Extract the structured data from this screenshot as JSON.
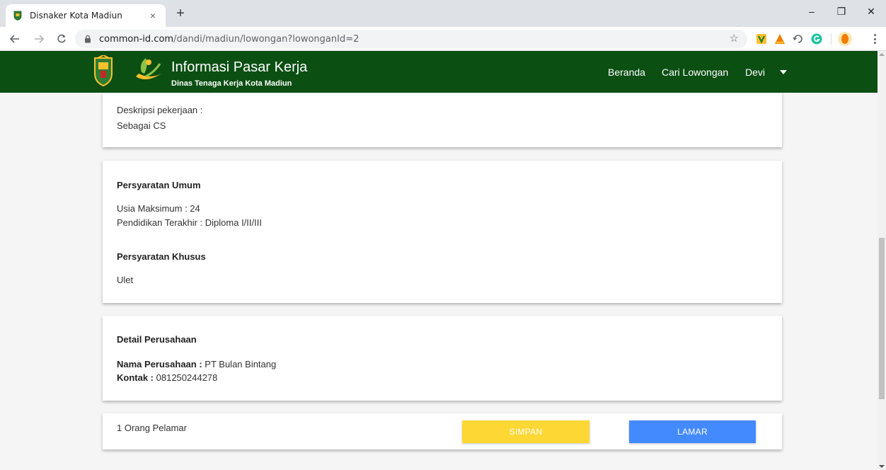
{
  "browser": {
    "tab_title": "Disnaker Kota Madiun",
    "tab_close": "×",
    "new_tab": "+",
    "url_domain": "common-id.com",
    "url_path": "/dandi/madiun/lowongan?lowonganId=2",
    "controls": {
      "minimize": "–",
      "restore": "❐",
      "close": "✕"
    }
  },
  "header": {
    "title": "Informasi Pasar Kerja",
    "subtitle": "Dinas Tenaga Kerja Kota Madiun",
    "nav": {
      "home": "Beranda",
      "search": "Cari Lowongan",
      "user": "Devi"
    }
  },
  "description": {
    "label": "Deskripsi pekerjaan :",
    "value": "Sebagai CS"
  },
  "requirements": {
    "general_heading": "Persyaratan Umum",
    "age_label": "Usia Maksimum : 24",
    "education_label": "Pendidikan Terakhir : Diploma I/II/III",
    "special_heading": "Persyaratan Khusus",
    "special_value": "Ulet"
  },
  "company": {
    "heading": "Detail Perusahaan",
    "name_label": "Nama Perusahaan :",
    "name_value": "PT Bulan Bintang",
    "contact_label": "Kontak :",
    "contact_value": "081250244278"
  },
  "actions": {
    "applicants": "1 Orang Pelamar",
    "save_label": "SIMPAN",
    "apply_label": "LAMAR"
  },
  "colors": {
    "header_green": "#0b4f13",
    "save_yellow": "#fdd835",
    "apply_blue": "#448aff"
  }
}
